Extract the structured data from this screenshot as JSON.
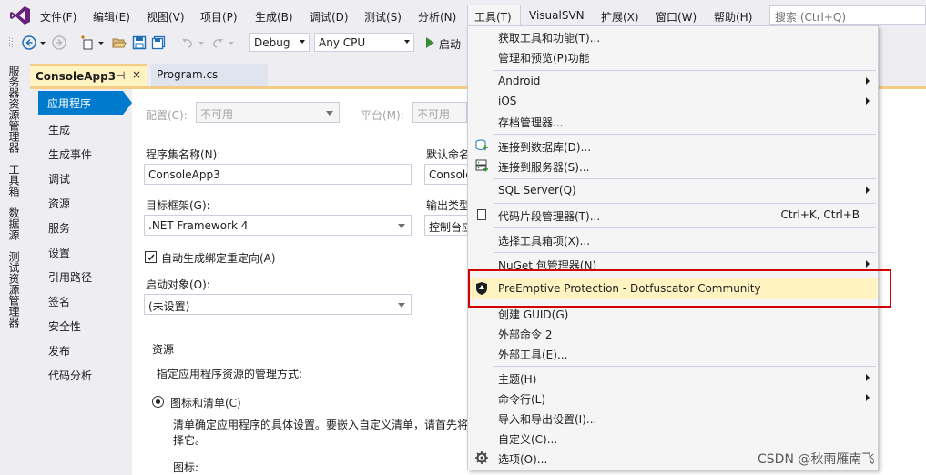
{
  "menubar": {
    "logo": "visual-studio-logo",
    "items": [
      "文件(F)",
      "编辑(E)",
      "视图(V)",
      "项目(P)",
      "生成(B)",
      "调试(D)",
      "测试(S)",
      "分析(N)",
      "工具(T)",
      "VisualSVN",
      "扩展(X)",
      "窗口(W)",
      "帮助(H)"
    ],
    "search_placeholder": "搜索 (Ctrl+Q)"
  },
  "toolbar": {
    "config": "Debug",
    "platform": "Any CPU",
    "start_label": "启动"
  },
  "left_rail": {
    "tabs": [
      "服务器资源管理器",
      "工具箱",
      "数据源",
      "测试资源管理器"
    ]
  },
  "doc_tabs": {
    "active": "ConsoleApp3",
    "pin": "⊣",
    "close": "×",
    "other": "Program.cs"
  },
  "properties": {
    "nav": [
      "应用程序",
      "生成",
      "生成事件",
      "调试",
      "资源",
      "服务",
      "设置",
      "引用路径",
      "签名",
      "安全性",
      "发布",
      "代码分析"
    ],
    "config_label": "配置(C):",
    "config_value": "不可用",
    "platform_label": "平台(M):",
    "platform_value": "不可用",
    "assembly_label": "程序集名称(N):",
    "assembly_value": "ConsoleApp3",
    "namespace_label": "默认命名",
    "namespace_value": "Console",
    "framework_label": "目标框架(G):",
    "framework_value": ".NET Framework 4",
    "output_label": "输出类型",
    "output_value": "控制台应",
    "autobind_label": "自动生成绑定重定向(A)",
    "startup_label": "启动对象(O):",
    "startup_value": "(未设置)",
    "resources_header": "资源",
    "resources_desc": "指定应用程序资源的管理方式:",
    "icon_manifest_label": "图标和清单(C)",
    "manifest_desc_1": "清单确定应用程序的具体设置。要嵌入自定义清单，请首先将",
    "manifest_desc_2": "择它。",
    "icon_label": "图标:"
  },
  "tools_menu": {
    "items": [
      {
        "label": "获取工具和功能(T)...",
        "icon": "",
        "shortcut": "",
        "submenu": false
      },
      {
        "label": "管理和预览(P)功能",
        "icon": "",
        "shortcut": "",
        "submenu": false
      },
      {
        "label": "Android",
        "icon": "",
        "shortcut": "",
        "submenu": true
      },
      {
        "label": "iOS",
        "icon": "",
        "shortcut": "",
        "submenu": true
      },
      {
        "label": "存档管理器...",
        "icon": "",
        "shortcut": "",
        "submenu": false
      },
      {
        "label": "连接到数据库(D)...",
        "icon": "database-connect-icon",
        "shortcut": "",
        "submenu": false
      },
      {
        "label": "连接到服务器(S)...",
        "icon": "server-connect-icon",
        "shortcut": "",
        "submenu": false
      },
      {
        "label": "SQL Server(Q)",
        "icon": "",
        "shortcut": "",
        "submenu": true
      },
      {
        "label": "代码片段管理器(T)...",
        "icon": "snippet-icon",
        "shortcut": "Ctrl+K, Ctrl+B",
        "submenu": false
      },
      {
        "label": "选择工具箱项(X)...",
        "icon": "",
        "shortcut": "",
        "submenu": false
      },
      {
        "label": "NuGet 包管理器(N)",
        "icon": "",
        "shortcut": "",
        "submenu": true
      },
      {
        "label": "PreEmptive Protection - Dotfuscator Community",
        "icon": "shield-icon",
        "shortcut": "",
        "submenu": false
      },
      {
        "label": "创建 GUID(G)",
        "icon": "",
        "shortcut": "",
        "submenu": false
      },
      {
        "label": "外部命令 2",
        "icon": "",
        "shortcut": "",
        "submenu": false
      },
      {
        "label": "外部工具(E)...",
        "icon": "",
        "shortcut": "",
        "submenu": false
      },
      {
        "label": "主题(H)",
        "icon": "",
        "shortcut": "",
        "submenu": true
      },
      {
        "label": "命令行(L)",
        "icon": "",
        "shortcut": "",
        "submenu": true
      },
      {
        "label": "导入和导出设置(I)...",
        "icon": "",
        "shortcut": "",
        "submenu": false
      },
      {
        "label": "自定义(C)...",
        "icon": "",
        "shortcut": "",
        "submenu": false
      },
      {
        "label": "选项(O)...",
        "icon": "gear-icon",
        "shortcut": "",
        "submenu": false
      }
    ]
  },
  "watermark": "CSDN @秋雨雁南飞",
  "colors": {
    "accent": "#007acc",
    "highlight": "#fff3c1",
    "annotation_red": "#d40000"
  }
}
